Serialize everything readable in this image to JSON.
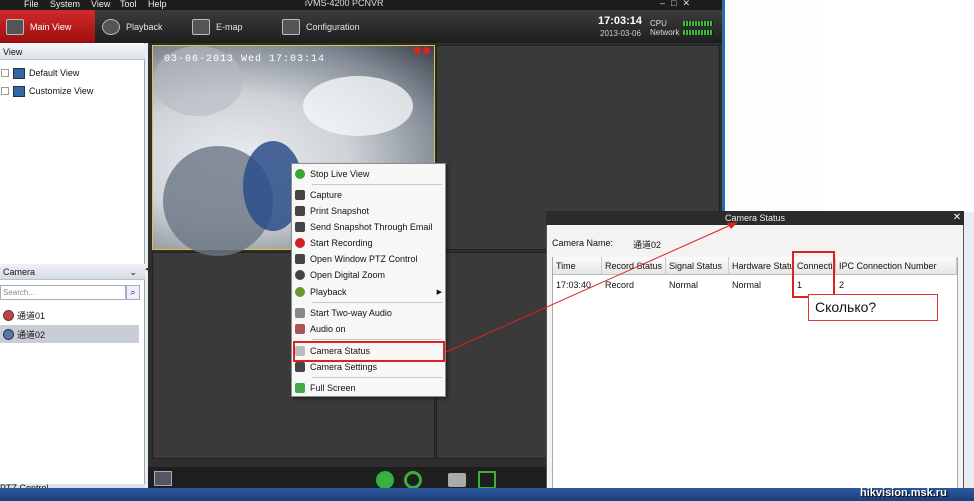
{
  "app": {
    "title": "iVMS-4200 PCNVR"
  },
  "menu": [
    "File",
    "System",
    "View",
    "Tool",
    "Help"
  ],
  "tabs": [
    "Main View",
    "Playback",
    "E-map",
    "Configuration"
  ],
  "status": {
    "time": "17:03:14",
    "date": "2013-03-06",
    "cpu": "CPU",
    "network": "Network"
  },
  "view_panel": {
    "title": "View",
    "items": [
      "Default View",
      "Customize View"
    ]
  },
  "camera_panel": {
    "title": "Camera",
    "search_placeholder": "Search...",
    "cameras": [
      "通道01",
      "通道02"
    ],
    "ptz": "PTZ Control"
  },
  "video": {
    "osd": "03-06-2013 Wed 17:03:14"
  },
  "context_menu": [
    "Stop Live View",
    "Capture",
    "Print Snapshot",
    "Send Snapshot Through Email",
    "Start Recording",
    "Open Window PTZ Control",
    "Open Digital Zoom",
    "Playback",
    "Start Two-way Audio",
    "Audio on",
    "Camera Status",
    "Camera Settings",
    "Full Screen"
  ],
  "dialog": {
    "title": "Camera Status",
    "camera_name_label": "Camera Name:",
    "camera_name": "通道02",
    "headers": [
      "Time",
      "Record Status",
      "Signal Status",
      "Hardware Status",
      "Connection",
      "IPC Connection Number"
    ],
    "row": [
      "17:03:40",
      "Record",
      "Normal",
      "Normal",
      "1",
      "2"
    ]
  },
  "annotation": "Сколько?",
  "watermark": "hikvision.msk.ru",
  "colors": {
    "accent": "#c41d1d",
    "highlight": "#e02020"
  }
}
